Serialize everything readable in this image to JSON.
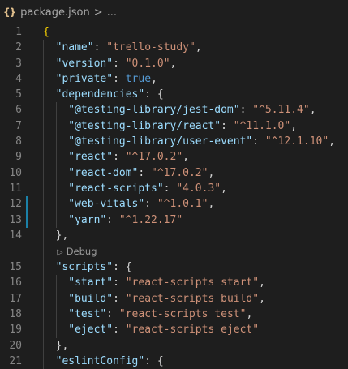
{
  "breadcrumb": {
    "file_icon": "{}",
    "file_name": "package.json",
    "separator": ">",
    "ellipsis": "..."
  },
  "codelens": {
    "icon": "▷",
    "label": "Debug"
  },
  "lines": [
    {
      "n": "1",
      "code": "{"
    },
    {
      "n": "2",
      "code": "\"name\": \"trello-study\","
    },
    {
      "n": "3",
      "code": "\"version\": \"0.1.0\","
    },
    {
      "n": "4",
      "code": "\"private\": true,"
    },
    {
      "n": "5",
      "code": "\"dependencies\": {"
    },
    {
      "n": "6",
      "code": "\"@testing-library/jest-dom\": \"^5.11.4\","
    },
    {
      "n": "7",
      "code": "\"@testing-library/react\": \"^11.1.0\","
    },
    {
      "n": "8",
      "code": "\"@testing-library/user-event\": \"^12.1.10\","
    },
    {
      "n": "9",
      "code": "\"react\": \"^17.0.2\","
    },
    {
      "n": "10",
      "code": "\"react-dom\": \"^17.0.2\","
    },
    {
      "n": "11",
      "code": "\"react-scripts\": \"4.0.3\","
    },
    {
      "n": "12",
      "code": "\"web-vitals\": \"^1.0.1\","
    },
    {
      "n": "13",
      "code": "\"yarn\": \"^1.22.17\""
    },
    {
      "n": "14",
      "code": "},"
    },
    {
      "n": "15",
      "code": "\"scripts\": {"
    },
    {
      "n": "16",
      "code": "\"start\": \"react-scripts start\","
    },
    {
      "n": "17",
      "code": "\"build\": \"react-scripts build\","
    },
    {
      "n": "18",
      "code": "\"test\": \"react-scripts test\","
    },
    {
      "n": "19",
      "code": "\"eject\": \"react-scripts eject\""
    },
    {
      "n": "20",
      "code": "},"
    },
    {
      "n": "21",
      "code": "\"eslintConfig\": {"
    }
  ],
  "colors": {
    "background": "#1e1e1e",
    "key": "#9cdcfe",
    "string": "#ce9178",
    "keyword": "#569cd6",
    "git_modified": "#1b81a8"
  }
}
